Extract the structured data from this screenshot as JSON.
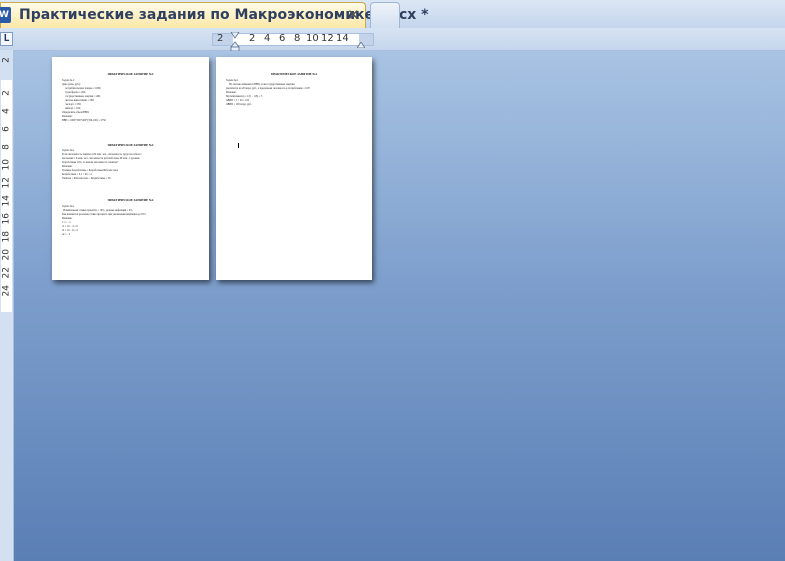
{
  "tab": {
    "icon_label": "W",
    "title": "Практические задания по Макроэкономике.docx *",
    "close_glyph": "✕"
  },
  "ruler": {
    "tab_selector": "L",
    "ticks": [
      "2",
      "2",
      "4",
      "6",
      "8",
      "10",
      "12",
      "14"
    ],
    "vertical_ticks": [
      "2",
      "2",
      "4",
      "6",
      "8",
      "10",
      "12",
      "14",
      "16",
      "18",
      "20",
      "22",
      "24"
    ]
  },
  "page1": {
    "heading1": "ПРАКТИЧЕСКОЕ ЗАНЯТИЕ №4",
    "block1": "Задача № 2\nДано (млн. руб.):\n     потребительские товары = 1600;\n     трансферты = 200;\n     государственные закупки = 400;\n     чистые инвестиции = 500;\n     экспорт = 350;\n     импорт = 100;\nОпределить объем ВВП.\nРешение:\nВВП = 1600+500+400+(350-100) = 2750\n",
    "heading2": "ПРАКТИЧЕСКОЕ ЗАНЯТИЕ №4",
    "block2": "Задача №4\nЕсли численность занятых 100 млн. чел., численность трудоспособного\nнаселения = 8 млн. чел., численность рабочей силы 40 млн., а уровень\nбезработицы 10%, то какова численность занятых?\nРешение:\nУровень безработицы = Безработные/Рабочая сила\nБезработные = 0,1 × 40 = 4\nЗанятые = Рабочая сила − Безработные = 36\n",
    "heading3": "ПРАКТИЧЕСКОЕ ЗАНЯТИЕ №4",
    "block3": "Задача №4\n  Номинальная ставка процента = 10%, уровень инфляции = 4%.\nКак изменится реальная ставка процента при увеличении инфляции до 6%?\nРешение:\nr = i − π\nr1 = 10 − 4 = 6\nr2 = 10 − 6 = 4\nΔr = −2"
  },
  "page2": {
    "heading1": "ПРАКТИЧЕСКОЕ ЗАНЯТИЕ №4",
    "block1": "Задача №4\n     На сколько изменится ВВП, если государственные закупки\nувеличатся на 20 млрд. руб., а предельная склонность к потреблению = 0,8?\nРешение:\nМультипликатор = 1/(1 − 0,8) = 5\nΔВВП = 5 × 20 = 100\nΔВВП = 100 млрд. руб."
  }
}
